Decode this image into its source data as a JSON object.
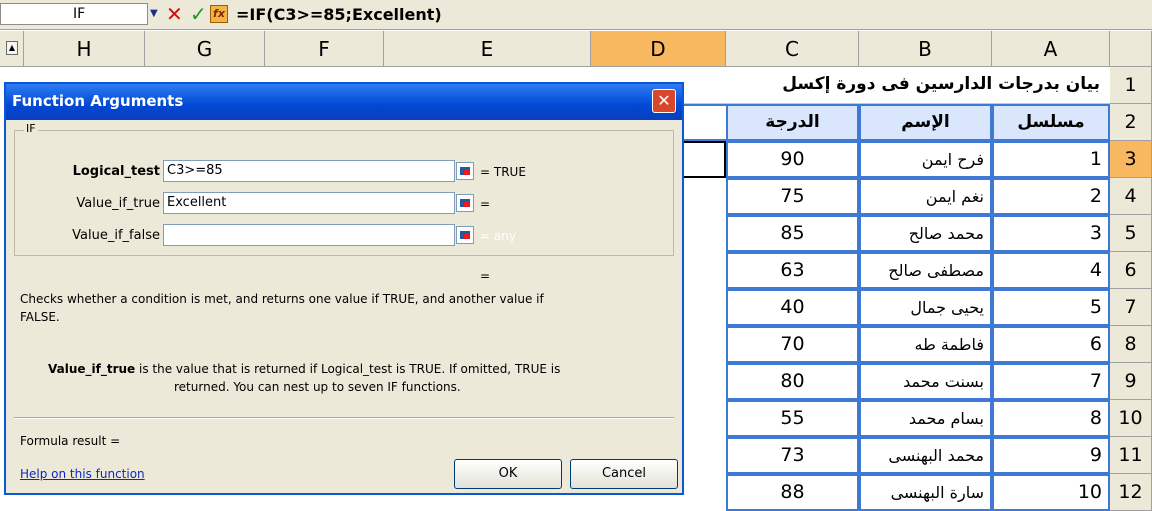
{
  "formula_bar": {
    "name_box": "IF",
    "formula": "=IF(C3>=85;Excellent)",
    "fx_label": "fx",
    "cancel_glyph": "✕",
    "enter_glyph": "✓",
    "dropdown_glyph": "▼"
  },
  "columns": [
    "H",
    "G",
    "F",
    "E",
    "D",
    "C",
    "B",
    "A"
  ],
  "rows": [
    "1",
    "2",
    "3",
    "4",
    "5",
    "6",
    "7",
    "8",
    "9",
    "10",
    "11",
    "12"
  ],
  "sheet": {
    "title": "بيان بدرجات الدارسين فى دورة إكسل",
    "headers": {
      "grade": "الدرجة",
      "name": "الإسم",
      "serial": "مسلسل"
    },
    "records": [
      {
        "serial": "1",
        "name": "فرح ايمن",
        "grade": "90"
      },
      {
        "serial": "2",
        "name": "نغم ايمن",
        "grade": "75"
      },
      {
        "serial": "3",
        "name": "محمد صالح",
        "grade": "85"
      },
      {
        "serial": "4",
        "name": "مصطفى صالح",
        "grade": "63"
      },
      {
        "serial": "5",
        "name": "يحيى جمال",
        "grade": "40"
      },
      {
        "serial": "6",
        "name": "فاطمة طه",
        "grade": "70"
      },
      {
        "serial": "7",
        "name": "بسنت محمد",
        "grade": "80"
      },
      {
        "serial": "8",
        "name": "بسام محمد",
        "grade": "55"
      },
      {
        "serial": "9",
        "name": "محمد البهنسى",
        "grade": "73"
      },
      {
        "serial": "10",
        "name": "سارة البهنسى",
        "grade": "88"
      }
    ]
  },
  "dialog": {
    "title": "Function Arguments",
    "close_glyph": "✕",
    "function_name": "IF",
    "args": [
      {
        "label": "Logical_test",
        "value": "C3>=85",
        "result": "= TRUE"
      },
      {
        "label": "Value_if_true",
        "value": "Excellent",
        "result": "="
      },
      {
        "label": "Value_if_false",
        "value": "",
        "result": "= any"
      }
    ],
    "overall_eq": "=",
    "description_1": "Checks whether a condition is met, and returns one value if TRUE, and another value if",
    "description_2": "FALSE.",
    "arg_help_name": "Value_if_true",
    "arg_help_1": " is the value that is returned if Logical_test is TRUE. If omitted, TRUE is",
    "arg_help_2": "returned. You can nest up to seven IF functions.",
    "formula_result": "Formula result =",
    "help_link": "Help on this function",
    "ok_label": "OK",
    "cancel_label": "Cancel"
  },
  "colors": {
    "selection": "#f8b860",
    "table_border": "#3f79d6",
    "title_bar": "#0048d4"
  },
  "icons": {
    "refedit": "range-select-icon",
    "close": "close-icon",
    "fx": "insert-function-icon"
  }
}
